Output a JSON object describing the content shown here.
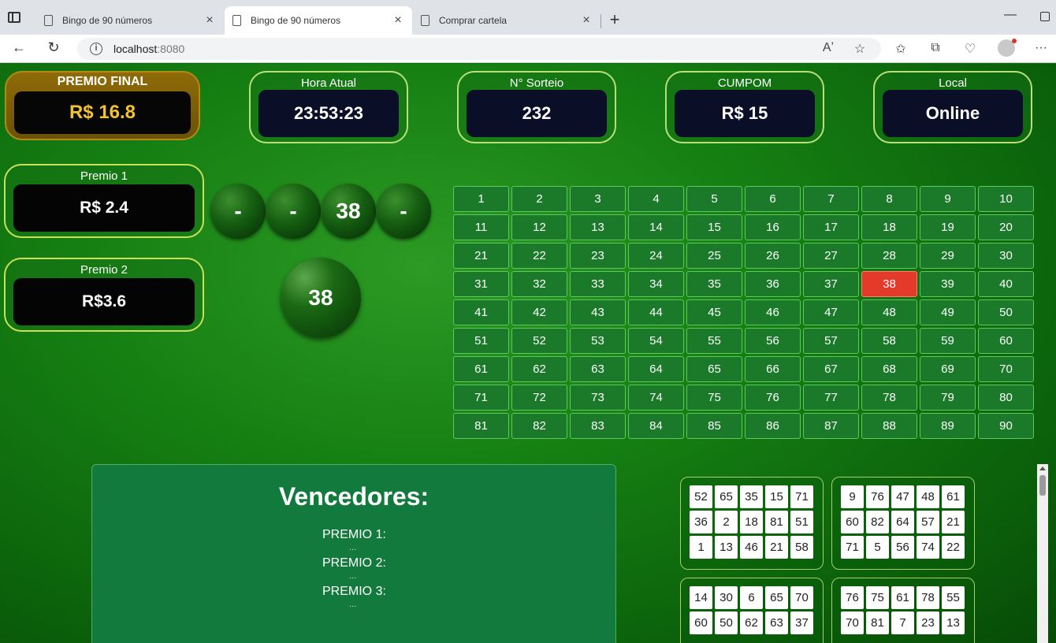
{
  "browser": {
    "tabs": [
      {
        "title": "Bingo de 90 números",
        "active": false
      },
      {
        "title": "Bingo de 90 números",
        "active": true
      },
      {
        "title": "Comprar cartela",
        "active": false
      }
    ],
    "url_host": "localhost",
    "url_port": ":8080"
  },
  "header": {
    "premio_final": {
      "label": "PREMIO FINAL",
      "value": "R$ 16.8"
    },
    "hora": {
      "label": "Hora Atual",
      "value": "23:53:23"
    },
    "sorteio": {
      "label": "N° Sorteio",
      "value": "232"
    },
    "cumpom": {
      "label": "CUMPOM",
      "value": "R$ 15"
    },
    "local": {
      "label": "Local",
      "value": "Online"
    }
  },
  "premios": [
    {
      "label": "Premio 1",
      "value": "R$ 2.4"
    },
    {
      "label": "Premio 2",
      "value": "R$3.6"
    }
  ],
  "recent_balls": [
    "-",
    "-",
    "38",
    "-"
  ],
  "current_ball": "38",
  "board": {
    "numbers": [
      1,
      2,
      3,
      4,
      5,
      6,
      7,
      8,
      9,
      10,
      11,
      12,
      13,
      14,
      15,
      16,
      17,
      18,
      19,
      20,
      21,
      22,
      23,
      24,
      25,
      26,
      27,
      28,
      29,
      30,
      31,
      32,
      33,
      34,
      35,
      36,
      37,
      38,
      39,
      40,
      41,
      42,
      43,
      44,
      45,
      46,
      47,
      48,
      49,
      50,
      51,
      52,
      53,
      54,
      55,
      56,
      57,
      58,
      59,
      60,
      61,
      62,
      63,
      64,
      65,
      66,
      67,
      68,
      69,
      70,
      71,
      72,
      73,
      74,
      75,
      76,
      77,
      78,
      79,
      80,
      81,
      82,
      83,
      84,
      85,
      86,
      87,
      88,
      89,
      90
    ],
    "drawn": [
      38
    ]
  },
  "winners": {
    "title": "Vencedores:",
    "lines": [
      {
        "label": "PREMIO 1:",
        "value": "..."
      },
      {
        "label": "PREMIO 2:",
        "value": "..."
      },
      {
        "label": "PREMIO 3:",
        "value": "..."
      }
    ]
  },
  "cards": [
    [
      52,
      65,
      35,
      15,
      71,
      36,
      2,
      18,
      81,
      51,
      1,
      13,
      46,
      21,
      58
    ],
    [
      9,
      76,
      47,
      48,
      61,
      60,
      82,
      64,
      57,
      21,
      71,
      5,
      56,
      74,
      22
    ],
    [
      14,
      30,
      6,
      65,
      70,
      60,
      50,
      62,
      63,
      37
    ],
    [
      76,
      75,
      61,
      78,
      55,
      70,
      81,
      7,
      23,
      13
    ]
  ],
  "colors": {
    "drawn": "#e33a2c",
    "cell": "#1b7a2a",
    "gold": "#f3c230"
  }
}
